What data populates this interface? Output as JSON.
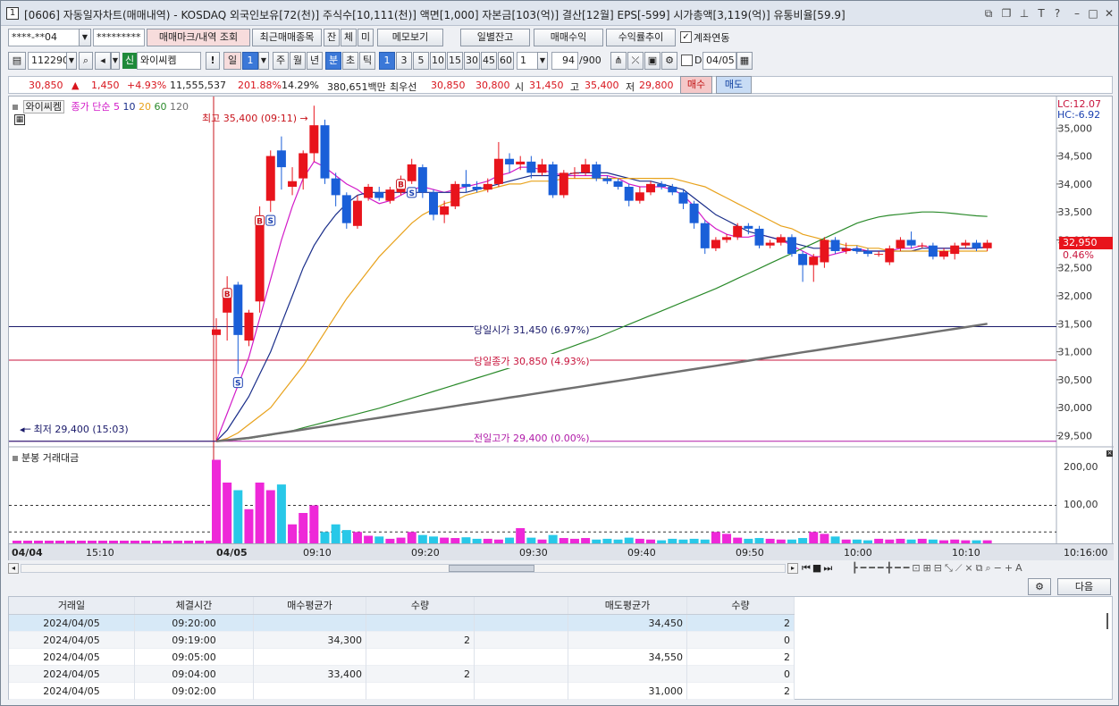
{
  "window": {
    "title": "[0606] 자동일자차트(매매내역) - KOSDAQ 외국인보유[72(천)] 주식수[10,111(천)] 액면[1,000] 자본금[103(억)] 결산[12월] EPS[-599] 시가총액[3,119(억)] 유통비율[59.9]",
    "app_number": "1"
  },
  "toolbar1": {
    "account_value": "****-**04",
    "password_value": "*********",
    "trade_mark_btn": "매매마크/내역 조회",
    "recent_btn": "최근매매종목",
    "jan_btn": "잔",
    "che_btn": "체",
    "mi_btn": "미",
    "memo_btn": "메모보기",
    "daily_balance_btn": "일별잔고",
    "trade_profit_btn": "매매수익",
    "profit_trend_btn": "수익률추이",
    "account_link_label": "계좌연동",
    "account_link_checked": true
  },
  "toolbar2": {
    "code": "112290",
    "badge": "신",
    "name": "와이씨켐",
    "il": "일",
    "period_value": "1",
    "ju": "주",
    "wol": "월",
    "nyeon": "년",
    "bun": "분",
    "cho": "초",
    "tick": "틱",
    "intervals": [
      "1",
      "3",
      "5",
      "10",
      "15",
      "30",
      "45",
      "60"
    ],
    "n_value": "1",
    "count_value": "94",
    "count_total": "/900",
    "d_label": "D",
    "date_value": "04/05"
  },
  "quote": {
    "price": "30,850",
    "change": "1,450",
    "change_pct": "+4.93%",
    "volume": "11,555,537",
    "vol_ratio": "201.88%",
    "turnover": "14.29%",
    "amount": "380,651백만",
    "best_label": "최우선",
    "best_ask": "30,850",
    "best_bid": "30,800",
    "open_label": "시",
    "open": "31,450",
    "high_label": "고",
    "high": "35,400",
    "low_label": "저",
    "low": "29,800",
    "buy_btn": "매수",
    "sell_btn": "매도"
  },
  "chart_labels": {
    "legend_name": "와이씨켐",
    "legend_ma": "종가 단순",
    "ma_periods": [
      "5",
      "10",
      "20",
      "60",
      "120"
    ],
    "max_label": "최고 35,400 (09:11)",
    "min_label": "최저 29,400 (15:03)",
    "open_line_label": "당일시가 31,450 (6.97%)",
    "close_line_label": "당일종가 30,850 (4.93%)",
    "prev_high_label": "전일고가 29,400 (0.00%)",
    "lc": "LC:12.07",
    "hc": "HC:-6.92",
    "cur_price": "32,950",
    "cur_pct": "0.46%",
    "volume_title": "분봉 거래대금",
    "vol_ticks": [
      "200,00",
      "100,00"
    ],
    "time_start": "04/04",
    "time_labels": [
      "15:10",
      "04/05",
      "09:10",
      "09:20",
      "09:30",
      "09:40",
      "09:50",
      "10:00",
      "10:10"
    ],
    "time_end": "10:16:00"
  },
  "chart_data": {
    "type": "line",
    "title": "",
    "xlabel": "",
    "ylabel": "",
    "y_ticks": [
      35000,
      34500,
      34000,
      33500,
      33000,
      32500,
      32000,
      31500,
      31000,
      30500,
      30000,
      29500
    ],
    "ylim": [
      29300,
      35500
    ],
    "candles": [
      {
        "o": 31300,
        "c": 31400,
        "h": 31600,
        "l": 29400
      },
      {
        "o": 31700,
        "c": 32100,
        "h": 32350,
        "l": 31200
      },
      {
        "o": 32200,
        "c": 31300,
        "h": 32250,
        "l": 30600
      },
      {
        "o": 31200,
        "c": 31700,
        "h": 31750,
        "l": 31100
      },
      {
        "o": 31900,
        "c": 33400,
        "h": 33600,
        "l": 31700
      },
      {
        "o": 33700,
        "c": 34500,
        "h": 34600,
        "l": 33500
      },
      {
        "o": 34600,
        "c": 34300,
        "h": 34850,
        "l": 33900
      },
      {
        "o": 33950,
        "c": 34050,
        "h": 34300,
        "l": 33800
      },
      {
        "o": 34100,
        "c": 34550,
        "h": 34600,
        "l": 33900
      },
      {
        "o": 34550,
        "c": 35050,
        "h": 35400,
        "l": 34400
      },
      {
        "o": 35050,
        "c": 34100,
        "h": 35150,
        "l": 34000
      },
      {
        "o": 34100,
        "c": 33800,
        "h": 34200,
        "l": 33600
      },
      {
        "o": 33800,
        "c": 33300,
        "h": 33850,
        "l": 33200
      },
      {
        "o": 33250,
        "c": 33700,
        "h": 33800,
        "l": 33200
      },
      {
        "o": 33750,
        "c": 33950,
        "h": 34000,
        "l": 33700
      },
      {
        "o": 33850,
        "c": 33750,
        "h": 33950,
        "l": 33700
      },
      {
        "o": 33700,
        "c": 33900,
        "h": 33950,
        "l": 33650
      },
      {
        "o": 33850,
        "c": 34050,
        "h": 34150,
        "l": 33800
      },
      {
        "o": 34050,
        "c": 34350,
        "h": 34450,
        "l": 34000
      },
      {
        "o": 34300,
        "c": 33850,
        "h": 34350,
        "l": 33750
      },
      {
        "o": 33850,
        "c": 33450,
        "h": 33900,
        "l": 33350
      },
      {
        "o": 33450,
        "c": 33600,
        "h": 33700,
        "l": 33300
      },
      {
        "o": 33600,
        "c": 34000,
        "h": 34050,
        "l": 33550
      },
      {
        "o": 34000,
        "c": 33950,
        "h": 34250,
        "l": 33850
      },
      {
        "o": 33950,
        "c": 33900,
        "h": 34050,
        "l": 33850
      },
      {
        "o": 33900,
        "c": 34000,
        "h": 34100,
        "l": 33850
      },
      {
        "o": 34000,
        "c": 34450,
        "h": 34750,
        "l": 33950
      },
      {
        "o": 34450,
        "c": 34350,
        "h": 34550,
        "l": 34200
      },
      {
        "o": 34350,
        "c": 34400,
        "h": 34500,
        "l": 34250
      },
      {
        "o": 34400,
        "c": 34200,
        "h": 34500,
        "l": 34100
      },
      {
        "o": 34200,
        "c": 34350,
        "h": 34450,
        "l": 34150
      },
      {
        "o": 34350,
        "c": 33800,
        "h": 34400,
        "l": 33750
      },
      {
        "o": 33800,
        "c": 34200,
        "h": 34250,
        "l": 33750
      },
      {
        "o": 34200,
        "c": 34200,
        "h": 34300,
        "l": 34100
      },
      {
        "o": 34200,
        "c": 34350,
        "h": 34450,
        "l": 34150
      },
      {
        "o": 34350,
        "c": 34100,
        "h": 34400,
        "l": 34050
      },
      {
        "o": 34100,
        "c": 34050,
        "h": 34150,
        "l": 34000
      },
      {
        "o": 34050,
        "c": 33950,
        "h": 34100,
        "l": 33900
      },
      {
        "o": 33950,
        "c": 33700,
        "h": 34000,
        "l": 33600
      },
      {
        "o": 33700,
        "c": 33850,
        "h": 33950,
        "l": 33650
      },
      {
        "o": 33850,
        "c": 34000,
        "h": 34050,
        "l": 33800
      },
      {
        "o": 34000,
        "c": 33950,
        "h": 34050,
        "l": 33900
      },
      {
        "o": 33950,
        "c": 33850,
        "h": 34000,
        "l": 33800
      },
      {
        "o": 33850,
        "c": 33650,
        "h": 33900,
        "l": 33550
      },
      {
        "o": 33650,
        "c": 33300,
        "h": 33700,
        "l": 33200
      },
      {
        "o": 33300,
        "c": 32850,
        "h": 33350,
        "l": 32750
      },
      {
        "o": 32850,
        "c": 33000,
        "h": 33050,
        "l": 32800
      },
      {
        "o": 33000,
        "c": 33050,
        "h": 33100,
        "l": 32950
      },
      {
        "o": 33050,
        "c": 33250,
        "h": 33300,
        "l": 33000
      },
      {
        "o": 33250,
        "c": 33200,
        "h": 33300,
        "l": 33100
      },
      {
        "o": 33200,
        "c": 32900,
        "h": 33250,
        "l": 32850
      },
      {
        "o": 32900,
        "c": 32950,
        "h": 33000,
        "l": 32850
      },
      {
        "o": 32950,
        "c": 33050,
        "h": 33100,
        "l": 32900
      },
      {
        "o": 33050,
        "c": 32750,
        "h": 33100,
        "l": 32700
      },
      {
        "o": 32750,
        "c": 32550,
        "h": 32800,
        "l": 32250
      },
      {
        "o": 32550,
        "c": 32700,
        "h": 32750,
        "l": 32250
      },
      {
        "o": 32600,
        "c": 33000,
        "h": 33050,
        "l": 32500
      },
      {
        "o": 33000,
        "c": 32800,
        "h": 33050,
        "l": 32750
      },
      {
        "o": 32800,
        "c": 32850,
        "h": 32950,
        "l": 32750
      },
      {
        "o": 32850,
        "c": 32800,
        "h": 32900,
        "l": 32750
      },
      {
        "o": 32800,
        "c": 32750,
        "h": 32850,
        "l": 32700
      },
      {
        "o": 32750,
        "c": 32750,
        "h": 32800,
        "l": 32700
      },
      {
        "o": 32600,
        "c": 32850,
        "h": 32900,
        "l": 32550
      },
      {
        "o": 32850,
        "c": 33000,
        "h": 33050,
        "l": 32800
      },
      {
        "o": 33000,
        "c": 32900,
        "h": 33150,
        "l": 32850
      },
      {
        "o": 32900,
        "c": 32900,
        "h": 32950,
        "l": 32850
      },
      {
        "o": 32900,
        "c": 32700,
        "h": 32950,
        "l": 32650
      },
      {
        "o": 32700,
        "c": 32800,
        "h": 32850,
        "l": 32650
      },
      {
        "o": 32750,
        "c": 32900,
        "h": 32950,
        "l": 32650
      },
      {
        "o": 32900,
        "c": 32950,
        "h": 33000,
        "l": 32850
      },
      {
        "o": 32950,
        "c": 32850,
        "h": 33000,
        "l": 32800
      },
      {
        "o": 32850,
        "c": 32950,
        "h": 33000,
        "l": 32800
      }
    ],
    "volumes": [
      220,
      160,
      140,
      90,
      160,
      140,
      155,
      50,
      80,
      100,
      30,
      50,
      35,
      30,
      20,
      18,
      12,
      15,
      30,
      22,
      18,
      15,
      14,
      16,
      12,
      12,
      10,
      15,
      40,
      15,
      10,
      22,
      14,
      12,
      14,
      10,
      12,
      10,
      15,
      12,
      10,
      8,
      12,
      10,
      12,
      10,
      30,
      25,
      15,
      12,
      14,
      12,
      10,
      10,
      14,
      30,
      25,
      18,
      10,
      10,
      8,
      12,
      10,
      12,
      10,
      12,
      10,
      8,
      10,
      8,
      8,
      8
    ],
    "series": [
      {
        "name": "5",
        "color": "#d21ac8",
        "values": [
          29400,
          29900,
          30400,
          30900,
          31600,
          32300,
          33000,
          33600,
          34100,
          34400,
          34300,
          34150,
          34000,
          33900,
          33750,
          33650,
          33700,
          33800,
          33900,
          33950,
          33900,
          33850,
          33900,
          33950,
          34000,
          34050,
          34150,
          34200,
          34300,
          34300,
          34250,
          34200,
          34150,
          34150,
          34150,
          34150,
          34150,
          34100,
          34000,
          33950,
          33950,
          33950,
          33900,
          33800,
          33600,
          33350,
          33200,
          33100,
          33050,
          33050,
          33100,
          33050,
          33000,
          32900,
          32800,
          32700,
          32700,
          32750,
          32800,
          32850,
          32800,
          32800,
          32800,
          32850,
          32850,
          32900,
          32850,
          32850,
          32850,
          32850,
          32850,
          32880
        ]
      },
      {
        "name": "10",
        "color": "#1a2e8a",
        "values": [
          29400,
          29600,
          29900,
          30200,
          30600,
          31000,
          31500,
          32000,
          32500,
          32900,
          33200,
          33450,
          33650,
          33800,
          33850,
          33850,
          33850,
          33850,
          33850,
          33850,
          33850,
          33850,
          33850,
          33850,
          33900,
          33950,
          34000,
          34050,
          34100,
          34150,
          34150,
          34150,
          34150,
          34200,
          34200,
          34200,
          34200,
          34150,
          34100,
          34050,
          34050,
          34000,
          33950,
          33900,
          33750,
          33600,
          33450,
          33350,
          33250,
          33150,
          33100,
          33050,
          33000,
          32950,
          32900,
          32850,
          32850,
          32850,
          32850,
          32800,
          32800,
          32800,
          32800,
          32800,
          32800,
          32850,
          32850,
          32850,
          32850,
          32850,
          32850,
          32870
        ]
      },
      {
        "name": "20",
        "color": "#e8a21c",
        "values": [
          29400,
          29450,
          29550,
          29700,
          29850,
          30000,
          30250,
          30500,
          30750,
          31050,
          31350,
          31650,
          31950,
          32200,
          32450,
          32700,
          32900,
          33100,
          33300,
          33450,
          33550,
          33650,
          33700,
          33800,
          33850,
          33900,
          33950,
          34000,
          34000,
          34050,
          34050,
          34050,
          34100,
          34100,
          34100,
          34100,
          34100,
          34100,
          34100,
          34100,
          34100,
          34100,
          34100,
          34050,
          34000,
          33950,
          33850,
          33750,
          33650,
          33550,
          33450,
          33350,
          33250,
          33200,
          33100,
          33050,
          33000,
          32950,
          32900,
          32900,
          32850,
          32850,
          32800,
          32800,
          32800,
          32800,
          32800,
          32800,
          32800,
          32800,
          32800,
          32800
        ]
      },
      {
        "name": "60",
        "color": "#2a8a2a",
        "values": [
          29400,
          29410,
          29430,
          29450,
          29480,
          29510,
          29550,
          29590,
          29640,
          29690,
          29740,
          29790,
          29840,
          29890,
          29940,
          29990,
          30050,
          30110,
          30170,
          30230,
          30290,
          30350,
          30410,
          30470,
          30530,
          30590,
          30650,
          30710,
          30770,
          30830,
          30900,
          30970,
          31040,
          31110,
          31180,
          31250,
          31330,
          31410,
          31490,
          31570,
          31650,
          31730,
          31810,
          31890,
          31970,
          32050,
          32130,
          32220,
          32310,
          32400,
          32490,
          32580,
          32670,
          32760,
          32850,
          32940,
          33030,
          33120,
          33210,
          33300,
          33360,
          33410,
          33440,
          33460,
          33480,
          33500,
          33500,
          33490,
          33470,
          33450,
          33430,
          33420
        ]
      },
      {
        "name": "120",
        "color": "#707070",
        "values": [
          29400,
          29420,
          29440,
          29460,
          29490,
          29520,
          29550,
          29580,
          29610,
          29640,
          29670,
          29700,
          29730,
          29760,
          29790,
          29820,
          29850,
          29880,
          29910,
          29940,
          29970,
          30000,
          30030,
          30060,
          30090,
          30120,
          30150,
          30180,
          30210,
          30240,
          30270,
          30300,
          30330,
          30360,
          30390,
          30420,
          30450,
          30480,
          30510,
          30540,
          30570,
          30600,
          30630,
          30660,
          30690,
          30720,
          30750,
          30780,
          30810,
          30840,
          30870,
          30900,
          30930,
          30960,
          30990,
          31020,
          31050,
          31080,
          31110,
          31140,
          31170,
          31200,
          31230,
          31260,
          31290,
          31320,
          31350,
          31380,
          31410,
          31440,
          31470,
          31500
        ]
      }
    ],
    "hlines": [
      {
        "name": "open",
        "value": 31450,
        "color": "#1a1a6a"
      },
      {
        "name": "close",
        "value": 30850,
        "color": "#c8143c"
      },
      {
        "name": "prev_high",
        "value": 29400,
        "color": "#b01aa8"
      }
    ],
    "markers": [
      {
        "i": 1,
        "type": "B"
      },
      {
        "i": 2,
        "type": "S"
      },
      {
        "i": 4,
        "type": "B"
      },
      {
        "i": 5,
        "type": "S"
      },
      {
        "i": 17,
        "type": "B"
      },
      {
        "i": 18,
        "type": "S"
      }
    ]
  },
  "trade_table": {
    "settings_icon": "gear-icon",
    "next_btn": "다음",
    "columns": [
      "거래일",
      "체결시간",
      "매수평균가",
      "수량",
      "",
      "매도평균가",
      "수량"
    ],
    "rows": [
      [
        "2024/04/05",
        "09:20:00",
        "",
        "",
        "",
        "34,450",
        "2"
      ],
      [
        "2024/04/05",
        "09:19:00",
        "34,300",
        "2",
        "",
        "",
        "0"
      ],
      [
        "2024/04/05",
        "09:05:00",
        "",
        "",
        "",
        "34,550",
        "2"
      ],
      [
        "2024/04/05",
        "09:04:00",
        "33,400",
        "2",
        "",
        "",
        "0"
      ],
      [
        "2024/04/05",
        "09:02:00",
        "",
        "",
        "",
        "31,000",
        "2"
      ]
    ]
  }
}
